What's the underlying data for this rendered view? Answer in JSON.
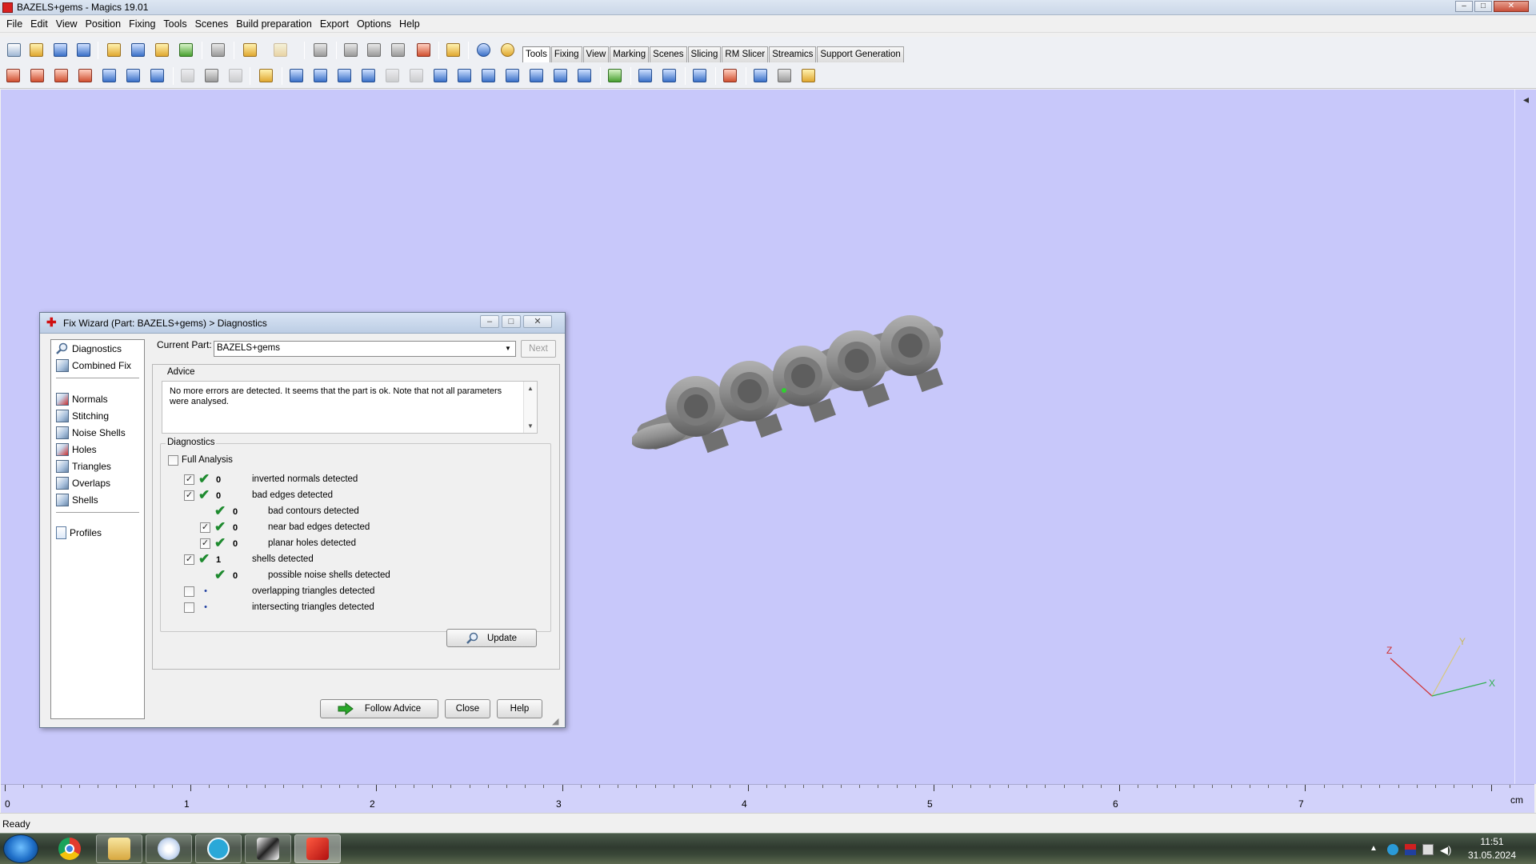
{
  "window": {
    "title": "BAZELS+gems - Magics 19.01",
    "controls": {
      "minimize": "–",
      "maximize": "□",
      "close": "✕"
    }
  },
  "menu": [
    "File",
    "Edit",
    "View",
    "Position",
    "Fixing",
    "Tools",
    "Scenes",
    "Build preparation",
    "Export",
    "Options",
    "Help"
  ],
  "tabs": [
    "Tools",
    "Fixing",
    "View",
    "Marking",
    "Scenes",
    "Slicing",
    "RM Slicer",
    "Streamics",
    "Support Generation"
  ],
  "active_tab": "Tools",
  "ruler": {
    "labels": [
      "0",
      "1",
      "2",
      "3",
      "4",
      "5",
      "6",
      "7"
    ],
    "unit": "cm"
  },
  "axes": {
    "x": "X",
    "y": "Y",
    "z": "Z"
  },
  "status": "Ready",
  "clock": {
    "time": "11:51",
    "date": "31.05.2024"
  },
  "dialog": {
    "title": "Fix Wizard (Part: BAZELS+gems) > Diagnostics",
    "nav": {
      "top": [
        "Diagnostics",
        "Combined Fix"
      ],
      "tools": [
        "Normals",
        "Stitching",
        "Noise Shells",
        "Holes",
        "Triangles",
        "Overlaps",
        "Shells"
      ],
      "bottom": [
        "Profiles"
      ]
    },
    "current_part_label": "Current Part:",
    "current_part_value": "BAZELS+gems",
    "next_label": "Next",
    "advice": {
      "title": "Advice",
      "text": "No more errors are detected. It seems that the part is ok. Note that not all parameters were analysed."
    },
    "diagnostics": {
      "title": "Diagnostics",
      "full_analysis": "Full Analysis",
      "rows": [
        {
          "checkbox": true,
          "checked": true,
          "status": "ok",
          "count": "0",
          "label": "inverted normals detected",
          "indent": 0
        },
        {
          "checkbox": true,
          "checked": true,
          "status": "ok",
          "count": "0",
          "label": "bad edges detected",
          "indent": 0
        },
        {
          "checkbox": false,
          "checked": false,
          "status": "ok",
          "count": "0",
          "label": "bad contours detected",
          "indent": 1
        },
        {
          "checkbox": true,
          "checked": true,
          "status": "ok",
          "count": "0",
          "label": "near bad edges detected",
          "indent": 1
        },
        {
          "checkbox": true,
          "checked": true,
          "status": "ok",
          "count": "0",
          "label": "planar holes detected",
          "indent": 1
        },
        {
          "checkbox": true,
          "checked": true,
          "status": "ok",
          "count": "1",
          "label": "shells detected",
          "indent": 0
        },
        {
          "checkbox": false,
          "checked": false,
          "status": "ok",
          "count": "0",
          "label": "possible noise shells detected",
          "indent": 1
        },
        {
          "checkbox": true,
          "checked": false,
          "status": "none",
          "count": "",
          "label": "overlapping triangles detected",
          "indent": 0
        },
        {
          "checkbox": true,
          "checked": false,
          "status": "none",
          "count": "",
          "label": "intersecting triangles detected",
          "indent": 0
        }
      ],
      "update_label": "Update"
    },
    "buttons": {
      "follow_advice": "Follow Advice",
      "close": "Close",
      "help": "Help"
    }
  },
  "colors": {
    "viewport": "#c8c8fa",
    "part": "#8e8e8e",
    "check": "#1d8a2e"
  }
}
